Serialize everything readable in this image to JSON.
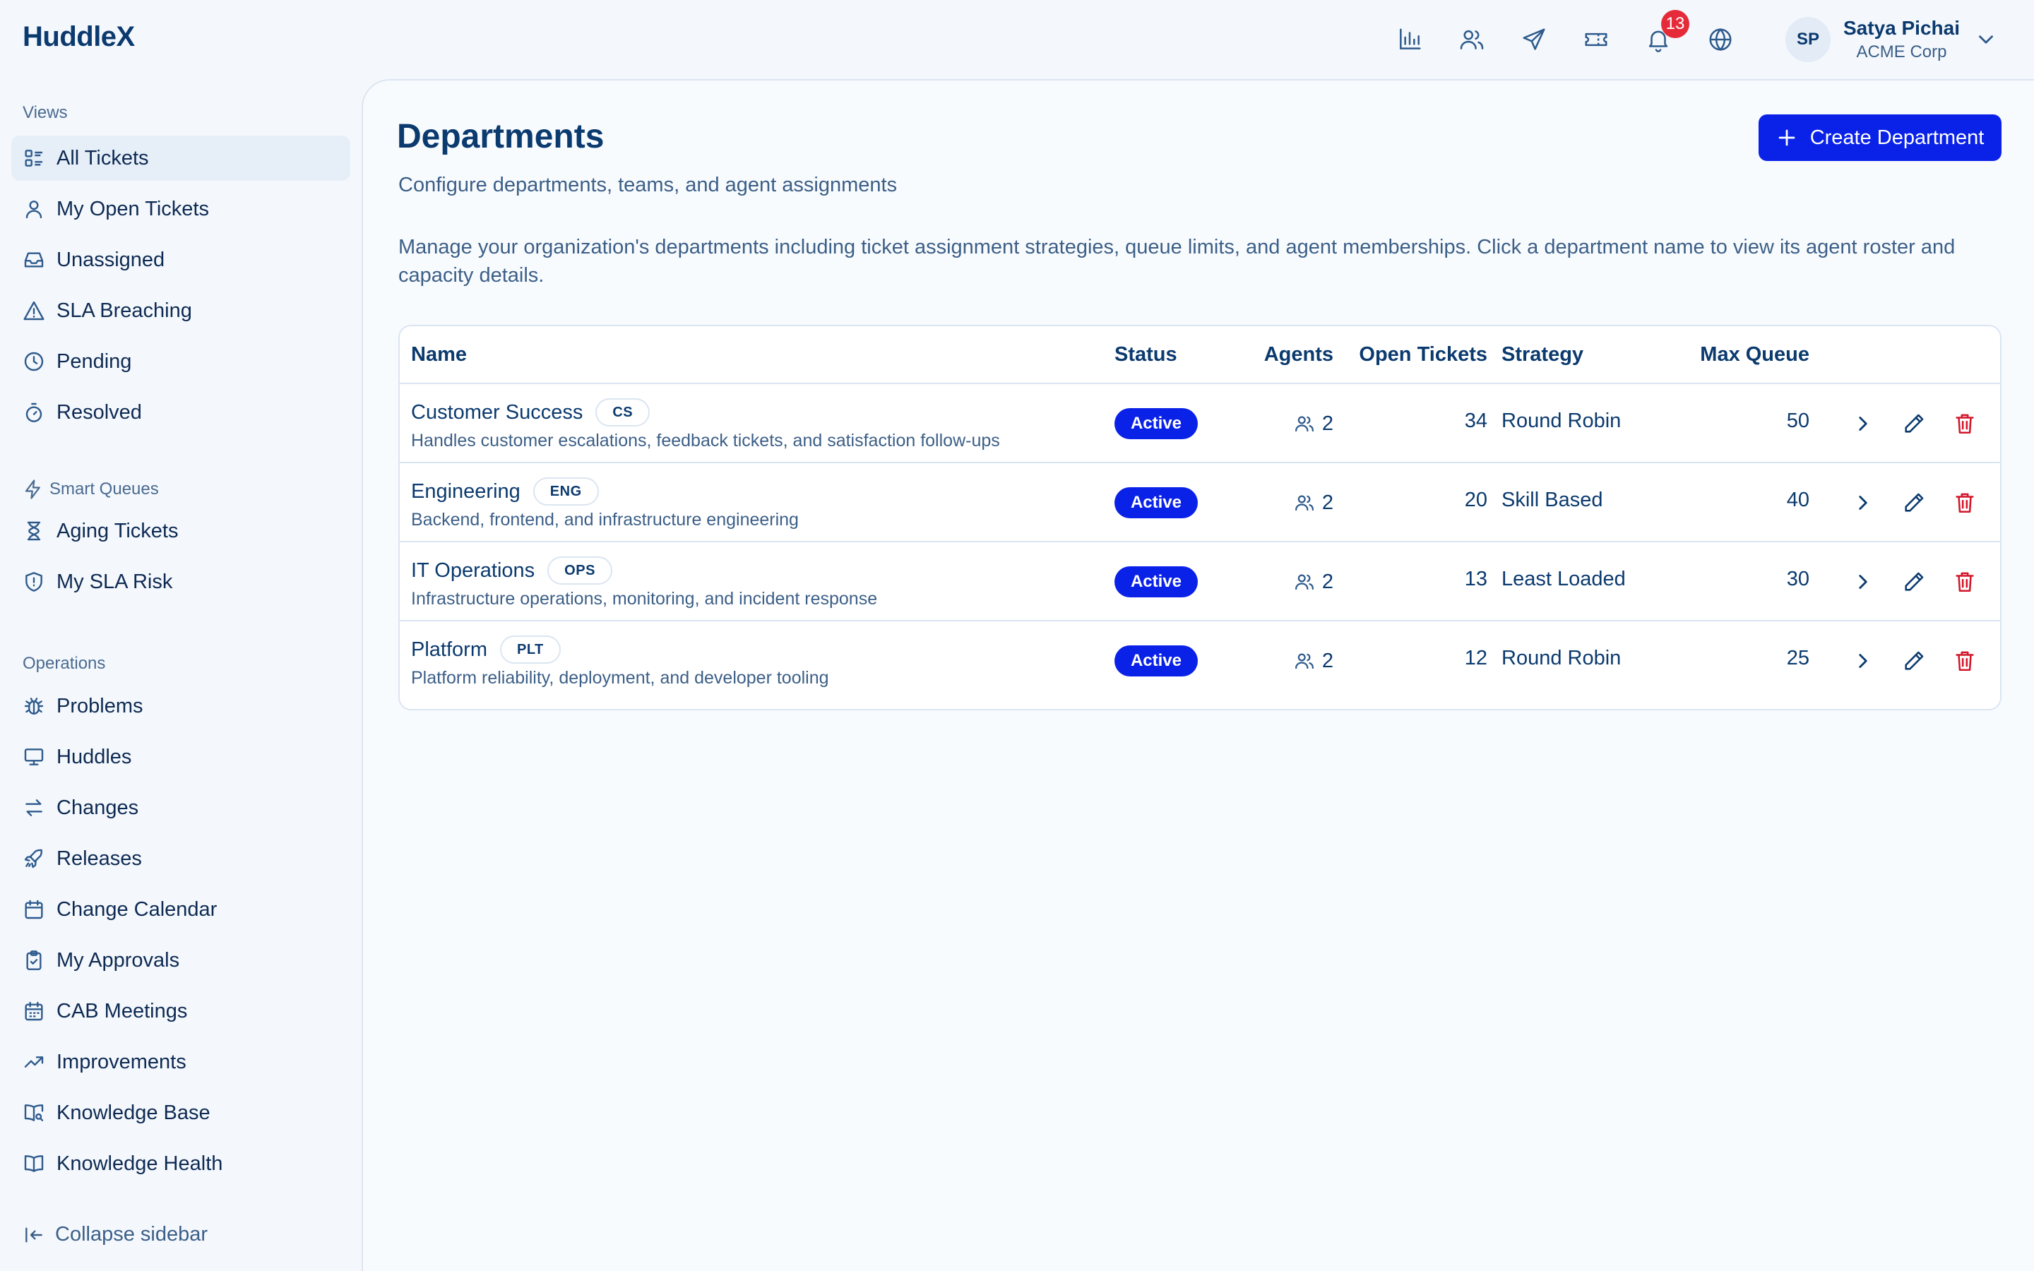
{
  "app": {
    "name": "HuddleX"
  },
  "header": {
    "icons": [
      "bar-chart-icon",
      "users-icon",
      "send-icon",
      "ticket-icon",
      "bell-icon",
      "globe-icon"
    ],
    "notification_count": "13",
    "user": {
      "initials": "SP",
      "name": "Satya Pichai",
      "org": "ACME Corp"
    }
  },
  "sidebar": {
    "views_label": "Views",
    "views": [
      {
        "label": "All Tickets",
        "icon": "list-icon",
        "active": true
      },
      {
        "label": "My Open Tickets",
        "icon": "user-icon"
      },
      {
        "label": "Unassigned",
        "icon": "inbox-icon"
      },
      {
        "label": "SLA Breaching",
        "icon": "warning-icon"
      },
      {
        "label": "Pending",
        "icon": "clock-icon"
      },
      {
        "label": "Resolved",
        "icon": "timer-icon"
      }
    ],
    "smart_label": "Smart Queues",
    "smart": [
      {
        "label": "Aging Tickets",
        "icon": "hourglass-icon"
      },
      {
        "label": "My SLA Risk",
        "icon": "shield-icon"
      }
    ],
    "operations_label": "Operations",
    "operations": [
      {
        "label": "Problems",
        "icon": "bug-icon"
      },
      {
        "label": "Huddles",
        "icon": "monitor-icon"
      },
      {
        "label": "Changes",
        "icon": "arrows-icon"
      },
      {
        "label": "Releases",
        "icon": "rocket-icon"
      },
      {
        "label": "Change Calendar",
        "icon": "calendar-icon"
      },
      {
        "label": "My Approvals",
        "icon": "clipboard-check-icon"
      },
      {
        "label": "CAB Meetings",
        "icon": "calendar-grid-icon"
      },
      {
        "label": "Improvements",
        "icon": "trending-up-icon"
      },
      {
        "label": "Knowledge Base",
        "icon": "book-search-icon"
      },
      {
        "label": "Knowledge Health",
        "icon": "book-open-icon"
      }
    ],
    "collapse_label": "Collapse sidebar"
  },
  "main": {
    "title": "Departments",
    "subtitle": "Configure departments, teams, and agent assignments",
    "description": "Manage your organization's departments including ticket assignment strategies, queue limits, and agent memberships. Click a department name to view its agent roster and capacity details.",
    "create_label": "Create Department",
    "table": {
      "columns": {
        "name": "Name",
        "status": "Status",
        "agents": "Agents",
        "open_tickets": "Open Tickets",
        "strategy": "Strategy",
        "max_queue": "Max Queue"
      },
      "rows": [
        {
          "name": "Customer Success",
          "code": "CS",
          "description": "Handles customer escalations, feedback tickets, and satisfaction follow-ups",
          "status": "Active",
          "agents": "2",
          "open_tickets": "34",
          "strategy": "Round Robin",
          "max_queue": "50"
        },
        {
          "name": "Engineering",
          "code": "ENG",
          "description": "Backend, frontend, and infrastructure engineering",
          "status": "Active",
          "agents": "2",
          "open_tickets": "20",
          "strategy": "Skill Based",
          "max_queue": "40"
        },
        {
          "name": "IT Operations",
          "code": "OPS",
          "description": "Infrastructure operations, monitoring, and incident response",
          "status": "Active",
          "agents": "2",
          "open_tickets": "13",
          "strategy": "Least Loaded",
          "max_queue": "30"
        },
        {
          "name": "Platform",
          "code": "PLT",
          "description": "Platform reliability, deployment, and developer tooling",
          "status": "Active",
          "agents": "2",
          "open_tickets": "12",
          "strategy": "Round Robin",
          "max_queue": "25"
        }
      ]
    }
  },
  "colors": {
    "brand": "#0b3a6e",
    "accent": "#0a22e8",
    "danger": "#d3162a",
    "badge": "#e52b3a"
  }
}
